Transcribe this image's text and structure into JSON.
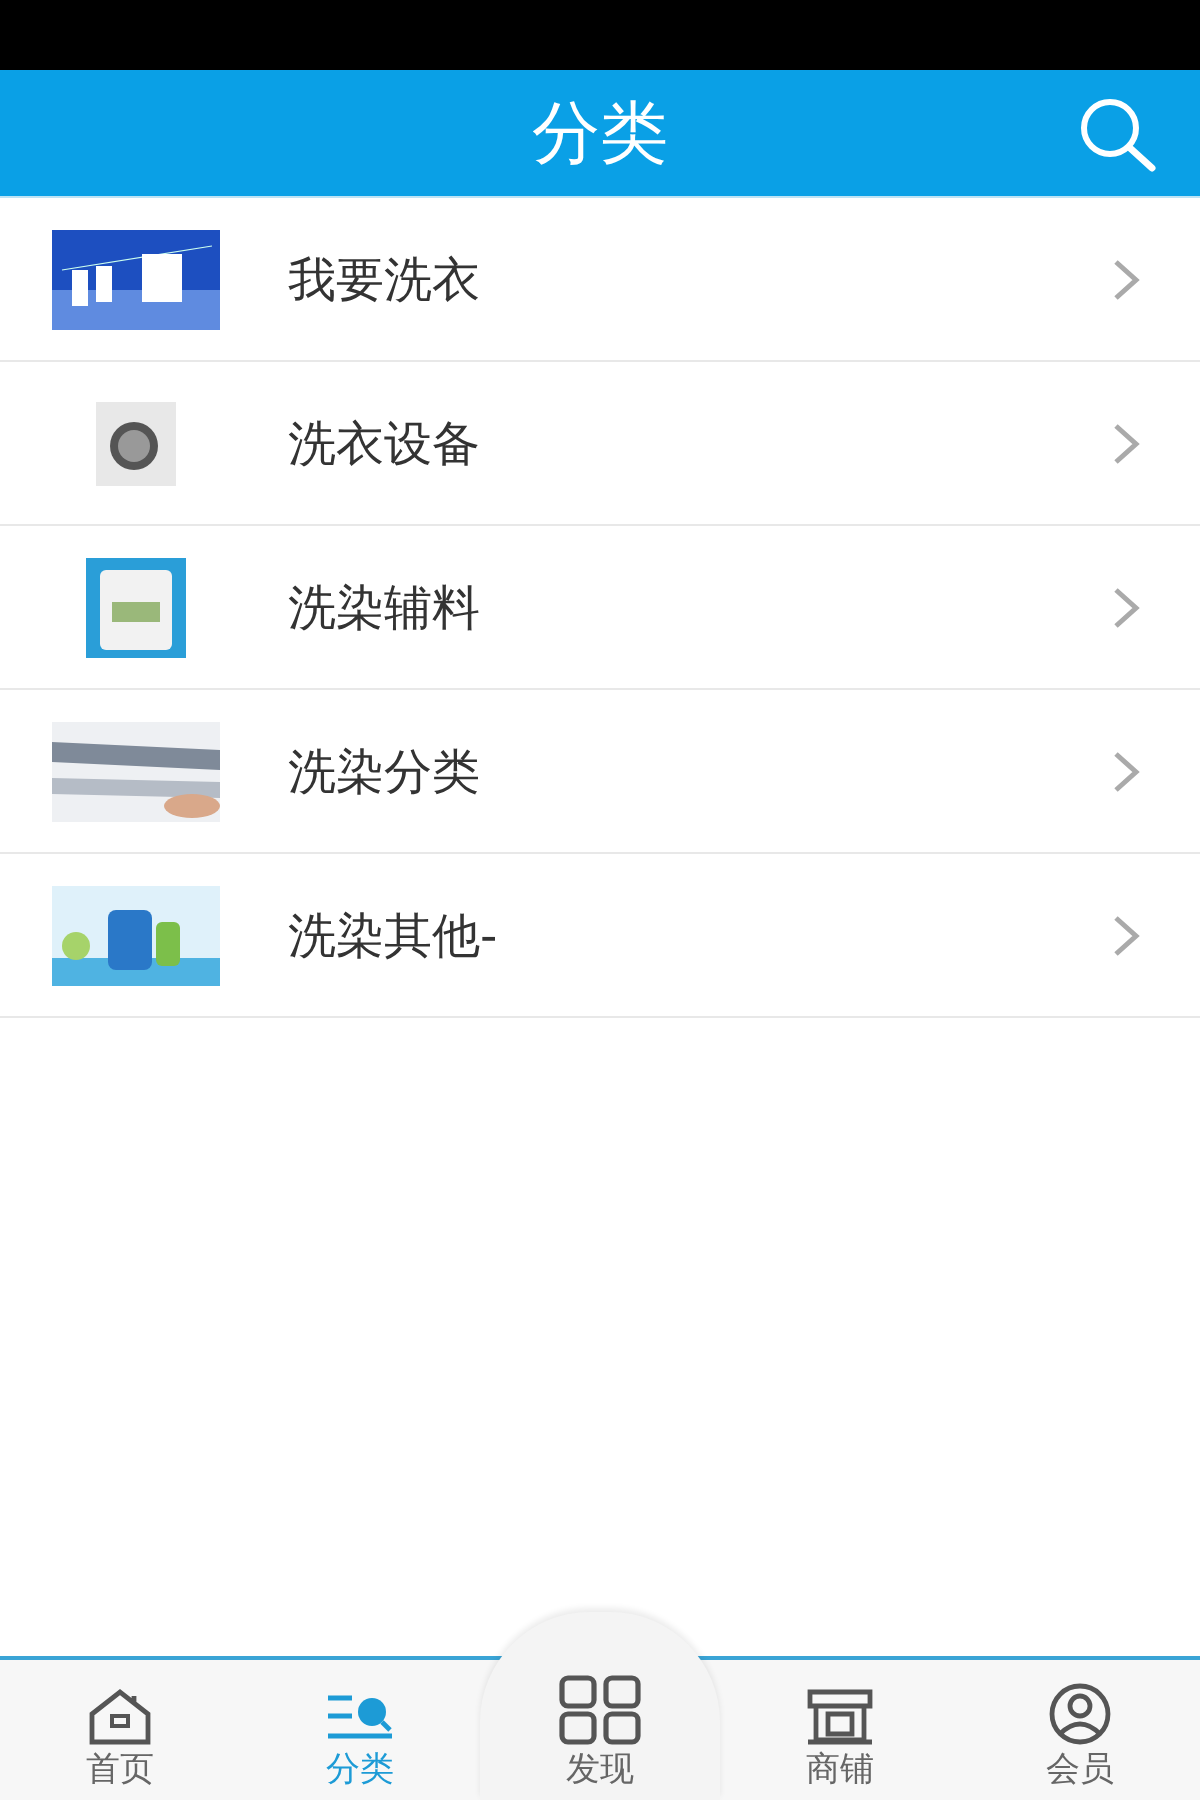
{
  "header": {
    "title": "分类"
  },
  "categories": [
    {
      "label": "我要洗衣",
      "kind": "picture"
    },
    {
      "label": "洗衣设备",
      "kind": "picture"
    },
    {
      "label": "洗染辅料",
      "kind": "picture"
    },
    {
      "label": "洗染分类",
      "kind": "picture"
    },
    {
      "label": "洗染其他-",
      "kind": "picture"
    }
  ],
  "tabs": [
    {
      "label": "首页",
      "kind": "home",
      "selected": false
    },
    {
      "label": "分类",
      "kind": "category",
      "selected": true
    },
    {
      "label": "发现",
      "kind": "discover",
      "selected": false
    },
    {
      "label": "商铺",
      "kind": "shop",
      "selected": false
    },
    {
      "label": "会员",
      "kind": "member",
      "selected": false
    }
  ]
}
